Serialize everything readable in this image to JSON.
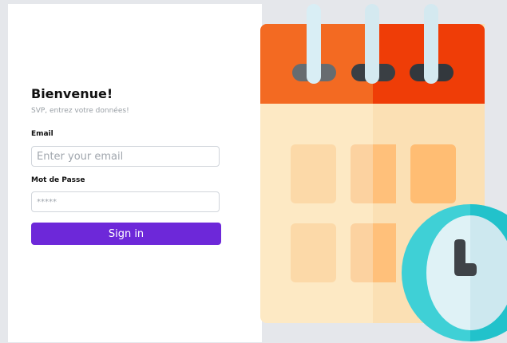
{
  "login": {
    "title": "Bienvenue!",
    "subtitle": "SVP, entrez votre données!",
    "email_label": "Email",
    "email_placeholder": "Enter your email",
    "email_value": "",
    "password_label": "Mot de Passe",
    "password_placeholder": "*****",
    "password_value": "",
    "signin_label": "Sign in"
  },
  "colors": {
    "accent": "#6d28d9",
    "calendar_header": "#f05a1e",
    "calendar_body": "#fde9c4",
    "clock_ring": "#3fd0d6"
  },
  "icons": {
    "illustration": "calendar-clock-icon"
  }
}
